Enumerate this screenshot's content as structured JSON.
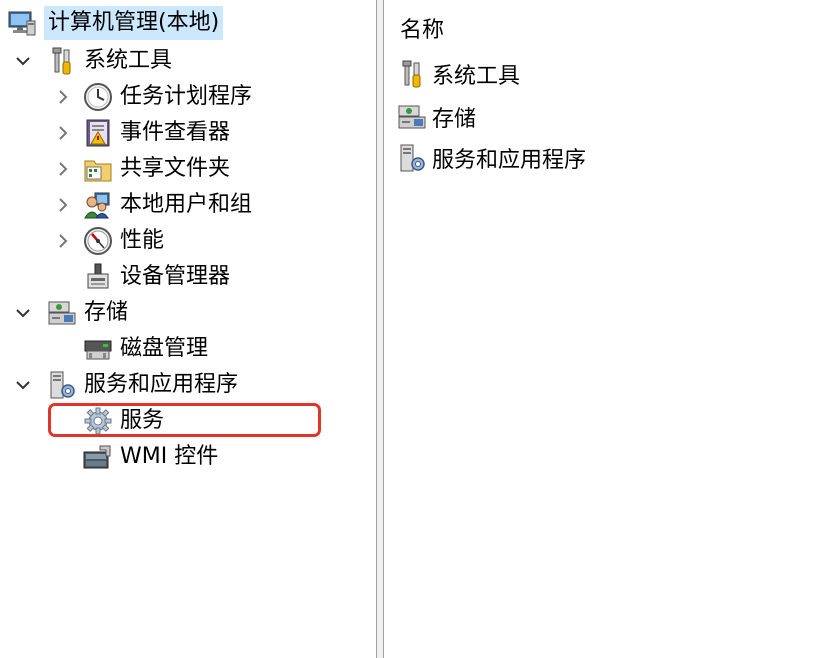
{
  "tree": {
    "root": {
      "label": "计算机管理(本地)",
      "icon": "computer-management-icon"
    },
    "items": [
      {
        "label": "系统工具",
        "icon": "system-tools-icon",
        "expanded": true,
        "children": [
          {
            "label": "任务计划程序",
            "icon": "task-scheduler-icon"
          },
          {
            "label": "事件查看器",
            "icon": "event-viewer-icon"
          },
          {
            "label": "共享文件夹",
            "icon": "shared-folders-icon"
          },
          {
            "label": "本地用户和组",
            "icon": "local-users-groups-icon"
          },
          {
            "label": "性能",
            "icon": "performance-icon"
          },
          {
            "label": "设备管理器",
            "icon": "device-manager-icon"
          }
        ]
      },
      {
        "label": "存储",
        "icon": "storage-icon",
        "expanded": true,
        "children": [
          {
            "label": "磁盘管理",
            "icon": "disk-management-icon"
          }
        ]
      },
      {
        "label": "服务和应用程序",
        "icon": "services-applications-icon",
        "expanded": true,
        "children": [
          {
            "label": "服务",
            "icon": "services-gear-icon"
          },
          {
            "label": "WMI 控件",
            "icon": "wmi-control-icon"
          }
        ]
      }
    ]
  },
  "list": {
    "header": "名称",
    "items": [
      {
        "label": "系统工具",
        "icon": "system-tools-icon"
      },
      {
        "label": "存储",
        "icon": "storage-icon"
      },
      {
        "label": "服务和应用程序",
        "icon": "services-applications-icon"
      }
    ]
  },
  "colors": {
    "selection": "#cce8ff",
    "highlight": "#e0352b"
  }
}
